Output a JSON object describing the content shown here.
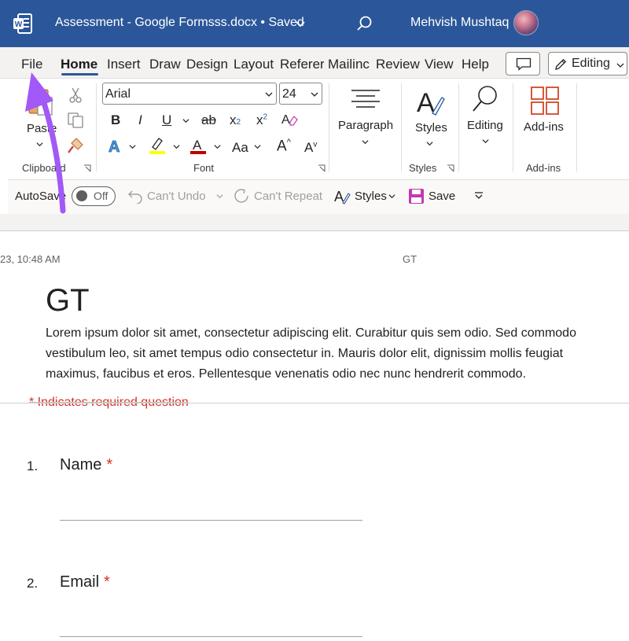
{
  "titlebar": {
    "doc_title": "Assessment - Google Formsss.docx • Saved",
    "user_name": "Mehvish Mushtaq"
  },
  "tabs": [
    {
      "label": "File",
      "active": false
    },
    {
      "label": "Home",
      "active": true
    },
    {
      "label": "Insert",
      "active": false
    },
    {
      "label": "Draw",
      "active": false
    },
    {
      "label": "Design",
      "active": false
    },
    {
      "label": "Layout",
      "active": false
    },
    {
      "label": "Referer",
      "active": false
    },
    {
      "label": "Mailinc",
      "active": false
    },
    {
      "label": "Review",
      "active": false
    },
    {
      "label": "View",
      "active": false
    },
    {
      "label": "Help",
      "active": false
    }
  ],
  "mode_button": {
    "label": "Editing"
  },
  "ribbon": {
    "clipboard": {
      "paste_label": "Paste",
      "group_label": "Clipboard"
    },
    "font": {
      "font_name": "Arial",
      "font_size": "24",
      "group_label": "Font",
      "bold": "B",
      "italic": "I",
      "underline": "U",
      "strike": "ab",
      "subscript": "x",
      "superscript": "x",
      "change_case": "Aa",
      "grow": "A",
      "shrink": "A"
    },
    "paragraph": {
      "label": "Paragraph"
    },
    "styles": {
      "label": "Styles",
      "group_label": "Styles"
    },
    "editing": {
      "label": "Editing"
    },
    "addins": {
      "label": "Add-ins",
      "group_label": "Add-ins"
    }
  },
  "quick_access": {
    "autosave_label": "AutoSave",
    "toggle_state": "Off",
    "undo_label": "Can't Undo",
    "repeat_label": "Can't Repeat",
    "styles_label": "Styles",
    "save_label": "Save"
  },
  "document": {
    "header_left": "23, 10:48 AM",
    "header_center": "GT",
    "heading": "GT",
    "paragraph": "Lorem ipsum dolor sit amet, consectetur adipiscing elit. Curabitur quis sem odio. Sed commodo vestibulum leo, sit amet tempus odio consectetur in. Mauris dolor elit, dignissim mollis feugiat maximus, faucibus et eros. Pellentesque venenatis odio nec nunc hendrerit commodo.",
    "required_note": "* Indicates required question",
    "questions": [
      {
        "number": "1.",
        "label": "Name",
        "required": "*"
      },
      {
        "number": "2.",
        "label": "Email",
        "required": "*"
      }
    ]
  },
  "colors": {
    "titlebar": "#2b579a",
    "accent_arrow": "#a259f7",
    "required_red": "#d93025"
  },
  "icons": [
    "word-logo-icon",
    "chevron-down-icon",
    "search-icon",
    "comment-icon",
    "pencil-icon",
    "paste-icon",
    "cut-icon",
    "copy-icon",
    "format-painter-icon",
    "font-color-icon",
    "highlight-icon",
    "text-effects-icon",
    "clear-formatting-icon",
    "paragraph-icon",
    "styles-icon",
    "find-icon",
    "add-ins-icon",
    "undo-icon",
    "redo-icon",
    "save-icon",
    "customize-qat-icon",
    "arrow-pointer-icon"
  ]
}
